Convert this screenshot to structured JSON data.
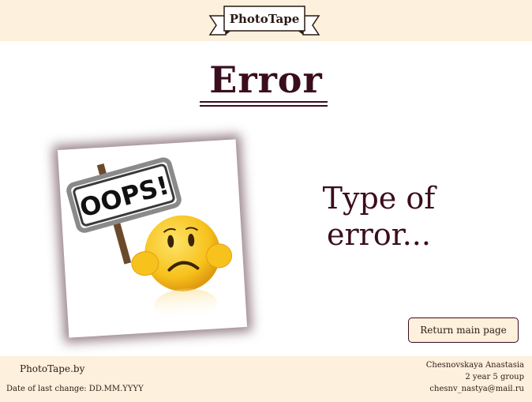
{
  "header": {
    "logo_text": "PhotoTape"
  },
  "main": {
    "title": "Error",
    "image": {
      "sign_text": "OOPS!",
      "icon": "sad-emoji-holding-sign"
    },
    "error_type_line1": "Type of",
    "error_type_line2": "error..."
  },
  "actions": {
    "return_label": "Return main page"
  },
  "footer": {
    "site_name": "PhotoTape.by",
    "last_change": "Date of last change: DD.MM.YYYY",
    "author_name": "Chesnovskaya Anastasia",
    "author_group": "2 year 5 group",
    "author_email": "chesnv_nastya@mail.ru"
  },
  "colors": {
    "header_bg": "#fdf0dc",
    "title": "#3a0d1e",
    "emoji": "#f7c21c"
  }
}
